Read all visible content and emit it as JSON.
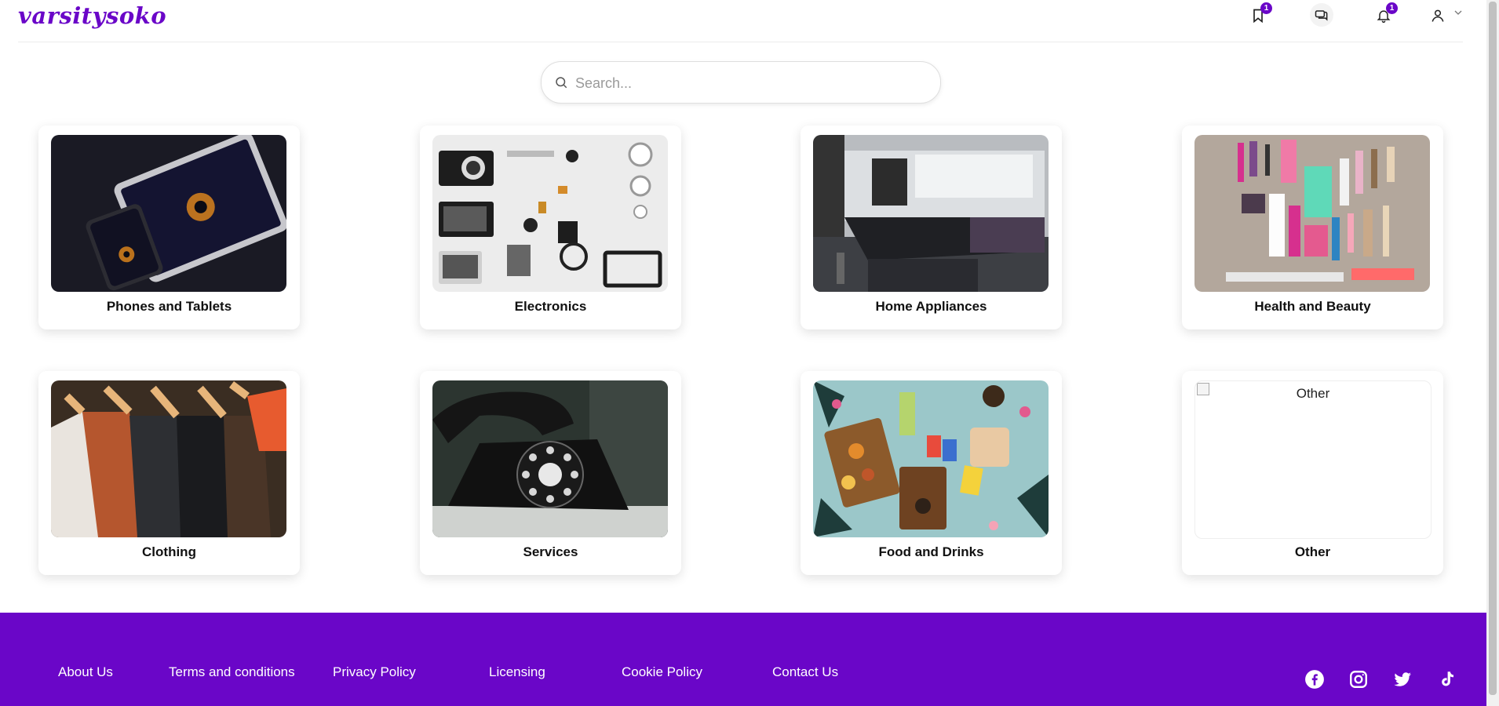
{
  "brand": {
    "logo_text": "varsitysoko",
    "color": "#6a06c8"
  },
  "header": {
    "saved_badge": "1",
    "notifications_badge": "1",
    "icons": [
      "bookmark-icon",
      "chat-icon",
      "bell-icon",
      "user-icon",
      "chevron-down-icon"
    ]
  },
  "search": {
    "placeholder": "Search..."
  },
  "categories": [
    {
      "label": "Phones and Tablets"
    },
    {
      "label": "Electronics"
    },
    {
      "label": "Home Appliances"
    },
    {
      "label": "Health and Beauty"
    },
    {
      "label": "Clothing"
    },
    {
      "label": "Services"
    },
    {
      "label": "Food and Drinks"
    },
    {
      "label": "Other",
      "image_alt": "Other"
    }
  ],
  "footer": {
    "links": [
      "About Us",
      "Terms and conditions",
      "Privacy Policy",
      "Licensing",
      "Cookie Policy",
      "Contact Us"
    ],
    "social_icons": [
      "facebook-icon",
      "instagram-icon",
      "twitter-icon",
      "tiktok-icon"
    ],
    "background": "#6a06c8"
  }
}
